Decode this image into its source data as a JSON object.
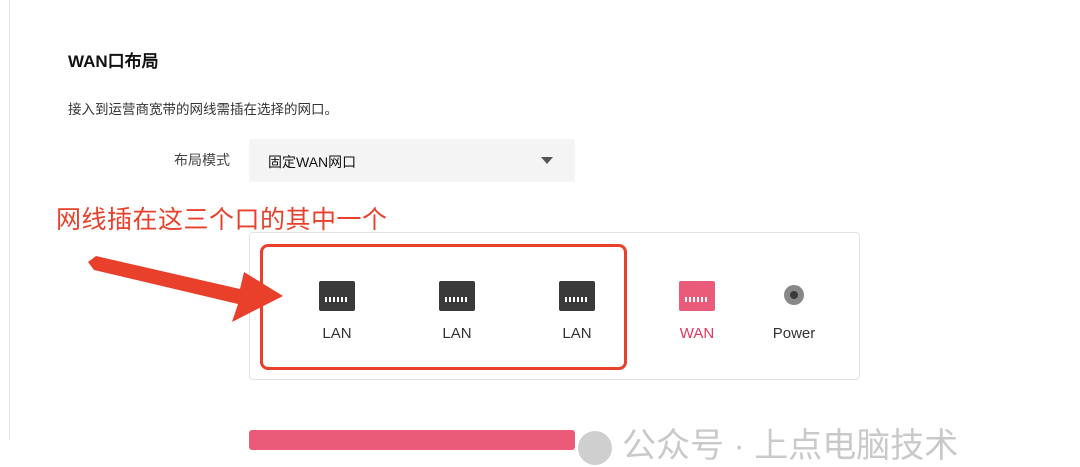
{
  "section": {
    "title": "WAN口布局",
    "description": "接入到运营商宽带的网线需插在选择的网口。"
  },
  "layout_mode": {
    "label": "布局模式",
    "selected": "固定WAN网口"
  },
  "annotation": {
    "text": "网线插在这三个口的其中一个",
    "color": "#e8402b"
  },
  "ports": [
    {
      "label": "LAN",
      "icon": "ethernet-port-icon"
    },
    {
      "label": "LAN",
      "icon": "ethernet-port-icon"
    },
    {
      "label": "LAN",
      "icon": "ethernet-port-icon"
    },
    {
      "label": "WAN",
      "icon": "ethernet-port-icon",
      "color": "#e0385e"
    },
    {
      "label": "Power",
      "icon": "power-jack-icon"
    }
  ],
  "watermark": {
    "text": "公众号 · 上点电脑技术"
  },
  "colors": {
    "accent": "#e95b78",
    "annotation": "#e8402b"
  }
}
